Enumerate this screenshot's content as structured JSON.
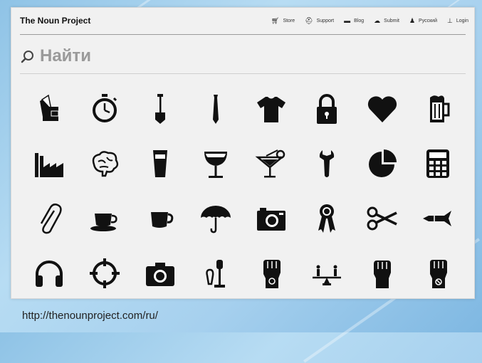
{
  "site": {
    "logo": "The Noun Project"
  },
  "nav": [
    {
      "label": "Store",
      "icon": "cart-icon"
    },
    {
      "label": "Support",
      "icon": "support-icon"
    },
    {
      "label": "Blog",
      "icon": "blog-icon"
    },
    {
      "label": "Submit",
      "icon": "submit-icon"
    },
    {
      "label": "Русский",
      "icon": "language-icon"
    },
    {
      "label": "Login",
      "icon": "user-icon"
    }
  ],
  "search": {
    "placeholder": "Найти",
    "value": ""
  },
  "icons": [
    "wallet-icon",
    "stopwatch-icon",
    "shovel-icon",
    "tie-icon",
    "tshirt-icon",
    "padlock-icon",
    "heart-icon",
    "beer-mug-icon",
    "factory-icon",
    "brain-icon",
    "pint-glass-icon",
    "wine-glass-icon",
    "cocktail-icon",
    "wrench-icon",
    "pie-chart-icon",
    "calculator-icon",
    "paperclip-icon",
    "coffee-cup-saucer-icon",
    "coffee-mug-icon",
    "umbrella-icon",
    "camera-icon",
    "award-ribbon-icon",
    "scissors-icon",
    "missile-icon",
    "headphones-icon",
    "crosshair-icon",
    "photo-camera-icon",
    "parking-meter-icon",
    "raised-fist-icon",
    "balance-scale-icon",
    "fist-icon",
    "fist-badge-icon"
  ],
  "caption": {
    "url": "http://thenounproject.com/ru/"
  }
}
